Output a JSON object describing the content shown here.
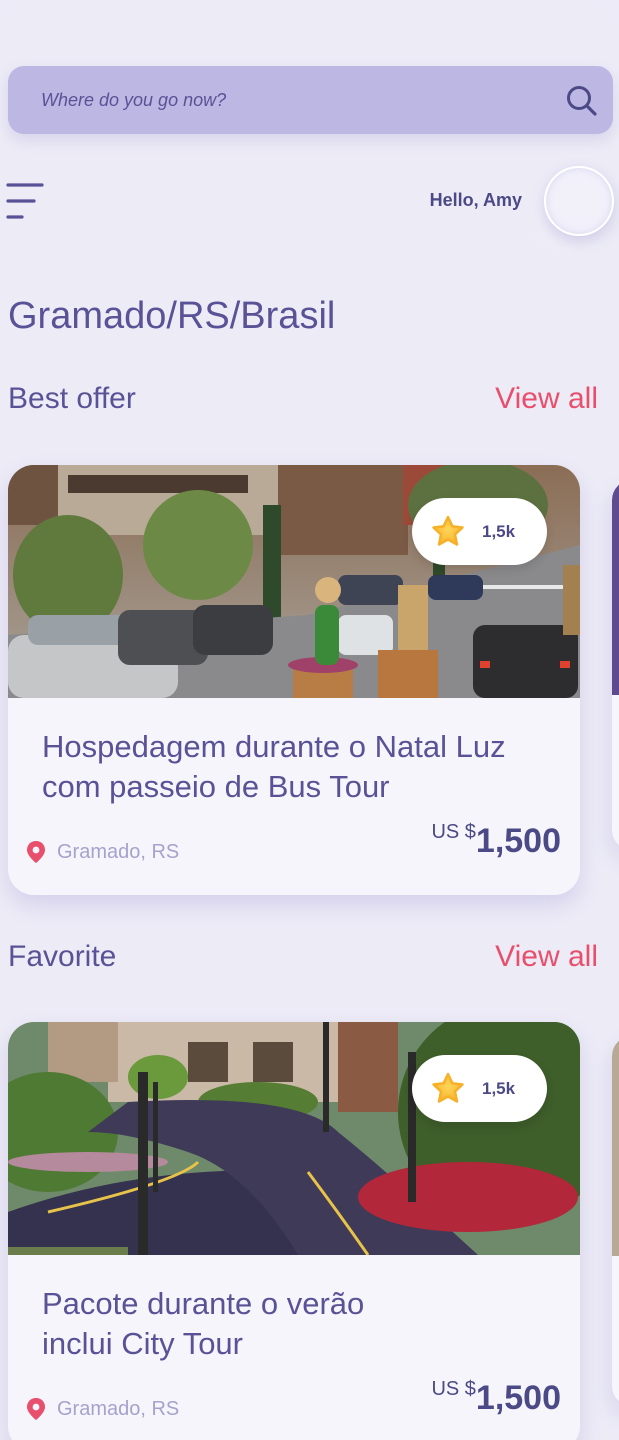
{
  "search": {
    "placeholder": "Where do you go now?"
  },
  "header": {
    "greeting": "Hello, Amy"
  },
  "location": {
    "title": "Gramado/RS/Brasil"
  },
  "sections": [
    {
      "title": "Best offer",
      "view_all": "View all",
      "card": {
        "title_line1": "Hospedagem durante o Natal Luz",
        "title_line2": "com passeio de Bus Tour",
        "rating": "1,5k",
        "location": "Gramado, RS",
        "currency": "US $",
        "price": "1,500"
      }
    },
    {
      "title": "Favorite",
      "view_all": "View all",
      "card": {
        "title_line1": "Pacote durante o verão",
        "title_line2": "inclui City Tour",
        "rating": "1,5k",
        "location": "Gramado, RS",
        "currency": "US $",
        "price": "1,500"
      }
    }
  ],
  "colors": {
    "background": "#ecebf6",
    "search_bg": "#bdb8e3",
    "primary_text": "#5a5296",
    "accent": "#e84f6c",
    "star": "#f9c23c"
  },
  "icons": [
    "search-icon",
    "menu-icon",
    "star-icon",
    "location-pin-icon"
  ]
}
